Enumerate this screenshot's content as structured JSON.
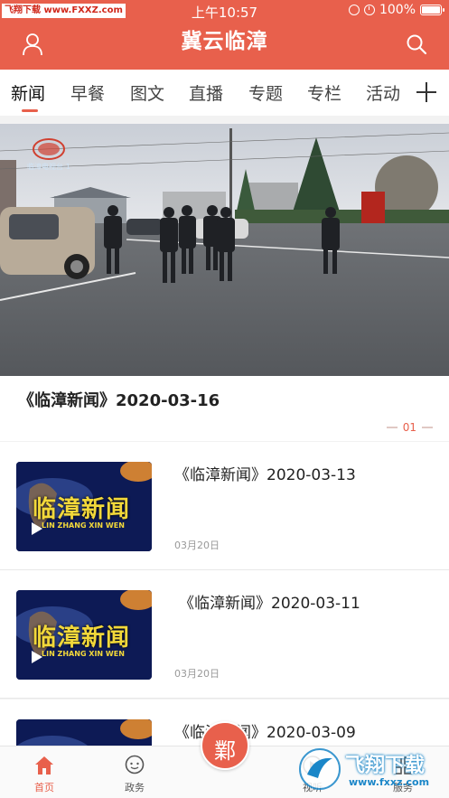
{
  "status_bar": {
    "watermark": "飞翔下载 www.FXXZ.com",
    "time": "上午10:57",
    "battery": "100%"
  },
  "header": {
    "title": "冀云临漳",
    "user_icon": "user-icon",
    "search_icon": "search-icon"
  },
  "tabs": [
    {
      "label": "新闻"
    },
    {
      "label": "早餐"
    },
    {
      "label": "图文"
    },
    {
      "label": "直播"
    },
    {
      "label": "专题"
    },
    {
      "label": "专栏"
    },
    {
      "label": "活动"
    }
  ],
  "hero": {
    "title": "《临漳新闻》2020-03-16",
    "page_indicator": "01",
    "channel_logo_text": "临漳电视台-1"
  },
  "news_list": [
    {
      "title": "《临漳新闻》2020-03-13",
      "date": "03月20日",
      "thumb_title": "临漳新闻",
      "thumb_sub": "LIN ZHANG XIN WEN"
    },
    {
      "title": "《临漳新闻》2020-03-11",
      "date": "03月20日",
      "thumb_title": "临漳新闻",
      "thumb_sub": "LIN ZHANG XIN WEN"
    },
    {
      "title": "《临漳新闻》2020-03-09",
      "date": "",
      "thumb_title": "",
      "thumb_sub": ""
    }
  ],
  "bottom_nav": {
    "items": [
      {
        "label": "首页",
        "icon": "home-icon"
      },
      {
        "label": "政务",
        "icon": "chat-icon"
      },
      {
        "label": "视听",
        "icon": "play-icon"
      },
      {
        "label": "服务",
        "icon": "grid-icon"
      }
    ],
    "center_seal_text": "鄴"
  },
  "watermark_bottom": {
    "text": "飞翔下载",
    "url": "www.fxxz.com"
  },
  "colors": {
    "brand": "#e8604c",
    "text": "#222222",
    "muted": "#999999"
  }
}
